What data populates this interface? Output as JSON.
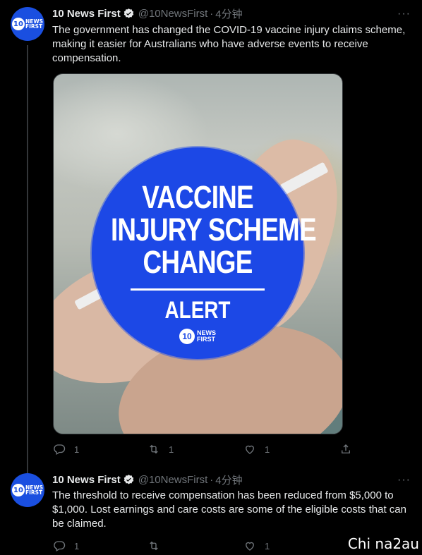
{
  "tweets": [
    {
      "author_name": "10 News First",
      "handle": "@10NewsFirst",
      "separator": "·",
      "time": "4分钟",
      "more": "···",
      "text": "The government has changed the COVID-19 vaccine injury claims scheme, making it easier for Australians who have adverse events to receive compensation.",
      "media": {
        "headline_lines": [
          "VACCINE",
          "INJURY SCHEME",
          "CHANGE"
        ],
        "alert": "ALERT",
        "logo_number": "10",
        "logo_text_top": "NEWS",
        "logo_text_bottom": "FIRST"
      },
      "actions": {
        "replies": "1",
        "retweets": "1",
        "likes": "1"
      }
    },
    {
      "author_name": "10 News First",
      "handle": "@10NewsFirst",
      "separator": "·",
      "time": "4分钟",
      "more": "···",
      "text": "The threshold to receive compensation has been reduced from $5,000 to $1,000. Lost earnings and care costs are some of the eligible costs that can be claimed.",
      "actions": {
        "replies": "1",
        "retweets": "",
        "likes": "1"
      }
    }
  ],
  "avatar": {
    "number": "10",
    "text_top": "NEWS",
    "text_bottom": "FIRST"
  },
  "watermark": "Chi na2au",
  "colors": {
    "background": "#000000",
    "text": "#e7e9ea",
    "muted": "#71767b",
    "brand_blue": "#1c48e6"
  }
}
